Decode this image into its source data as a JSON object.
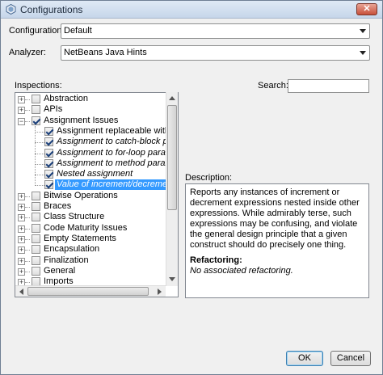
{
  "window": {
    "title": "Configurations",
    "close_label": "✕"
  },
  "config": {
    "label": "Configurations:",
    "value": "Default"
  },
  "analyzer": {
    "label": "Analyzer:",
    "value": "NetBeans Java Hints"
  },
  "inspections_label": "Inspections:",
  "search": {
    "label": "Search:",
    "value": "",
    "placeholder": ""
  },
  "tree": [
    {
      "label": "Abstraction",
      "expander": "+",
      "checked": false,
      "level": 0
    },
    {
      "label": "APIs",
      "expander": "+",
      "checked": false,
      "level": 0
    },
    {
      "label": "Assignment Issues",
      "expander": "−",
      "checked": true,
      "level": 0
    },
    {
      "label": "Assignment replaceable with opera",
      "checked": true,
      "level": 1,
      "italic": false
    },
    {
      "label": "Assignment to catch-block parame",
      "checked": true,
      "level": 1,
      "italic": true
    },
    {
      "label": "Assignment to for-loop parameter",
      "checked": true,
      "level": 1,
      "italic": true
    },
    {
      "label": "Assignment to method parameter",
      "checked": true,
      "level": 1,
      "italic": true
    },
    {
      "label": "Nested assignment",
      "checked": true,
      "level": 1,
      "italic": true
    },
    {
      "label": "Value of increment/decrement exp",
      "checked": true,
      "level": 1,
      "italic": true,
      "selected": true
    },
    {
      "label": "Bitwise Operations",
      "expander": "+",
      "checked": false,
      "level": 0
    },
    {
      "label": "Braces",
      "expander": "+",
      "checked": false,
      "level": 0
    },
    {
      "label": "Class Structure",
      "expander": "+",
      "checked": false,
      "level": 0
    },
    {
      "label": "Code Maturity Issues",
      "expander": "+",
      "checked": false,
      "level": 0
    },
    {
      "label": "Empty Statements",
      "expander": "+",
      "checked": false,
      "level": 0
    },
    {
      "label": "Encapsulation",
      "expander": "+",
      "checked": false,
      "level": 0
    },
    {
      "label": "Finalization",
      "expander": "+",
      "checked": false,
      "level": 0
    },
    {
      "label": "General",
      "expander": "+",
      "checked": false,
      "level": 0
    },
    {
      "label": "Imports",
      "expander": "+",
      "checked": false,
      "level": 0
    }
  ],
  "description": {
    "label": "Description:",
    "text": "Reports any instances of increment or decrement expressions nested inside other expressions. While admirably terse, such expressions may be confusing, and violate the general design principle that a given construct should do precisely one thing.",
    "refactoring_heading": "Refactoring:",
    "refactoring_text": "No associated refactoring."
  },
  "buttons": {
    "ok": "OK",
    "cancel": "Cancel"
  },
  "colors": {
    "selection": "#3399ff",
    "titlebar": "#c6d6ea"
  }
}
